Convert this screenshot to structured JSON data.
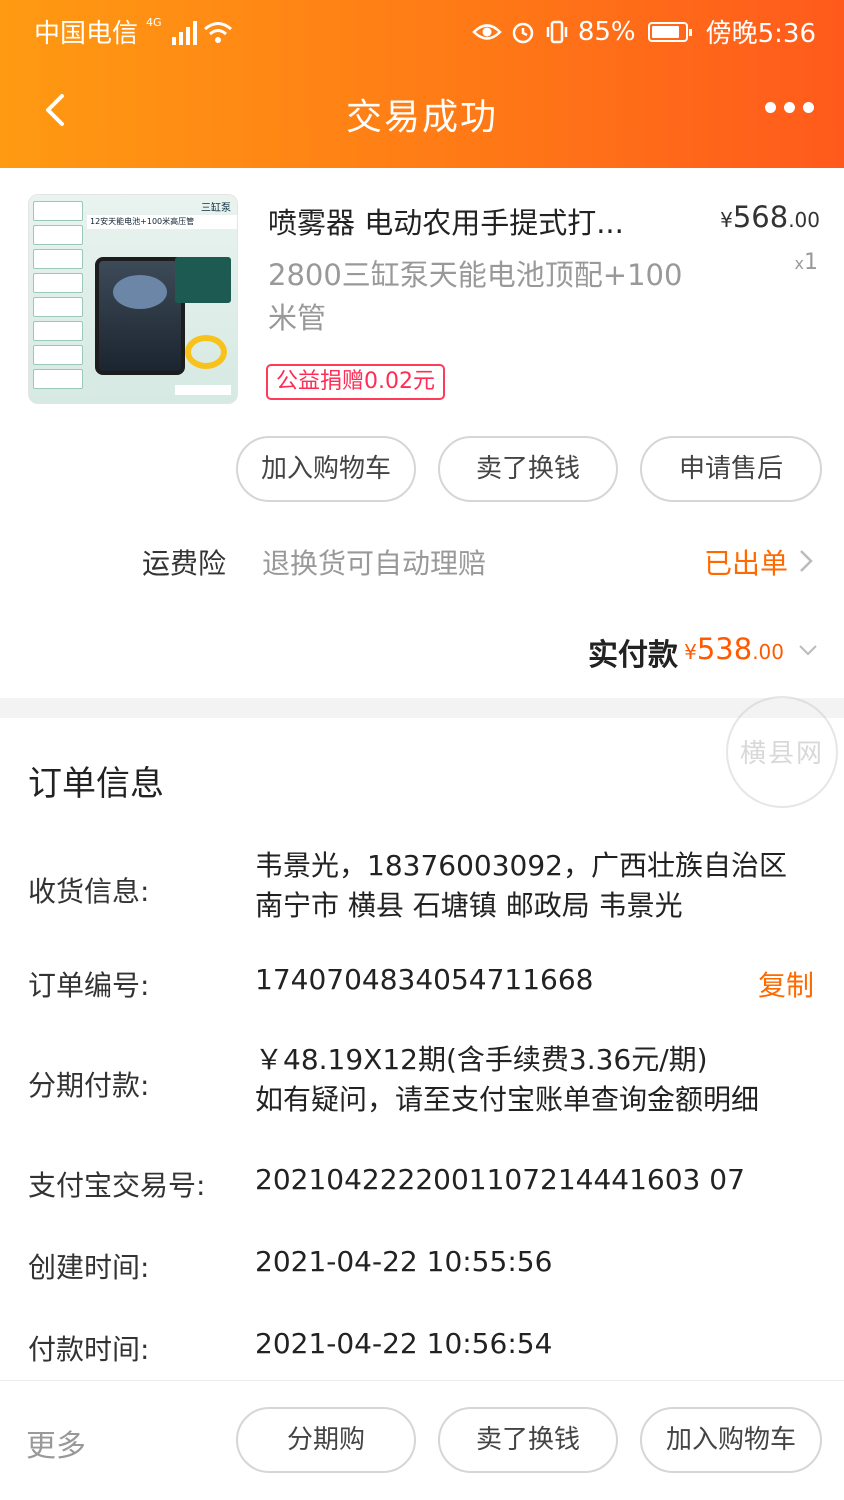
{
  "status_bar": {
    "carrier": "中国电信",
    "network": "4G",
    "battery": "85%",
    "battery_level": 0.85,
    "time": "傍晚5:36"
  },
  "nav": {
    "title": "交易成功"
  },
  "product": {
    "title": "喷雾器 电动农用手提式打...",
    "price_symbol": "¥",
    "price_int": "568",
    "price_dec": ".00",
    "qty_prefix": "x",
    "qty": "1",
    "sku": "2800三缸泵天能电池顶配+100米管",
    "badge": "公益捐赠0.02元",
    "image_text": {
      "tag": "三缸泵",
      "band": "12安天能电池+100米高压管"
    }
  },
  "item_actions": {
    "add_cart": "加入购物车",
    "resell": "卖了换钱",
    "after_sale": "申请售后"
  },
  "insurance": {
    "label": "运费险",
    "desc": "退换货可自动理赔",
    "status": "已出单"
  },
  "payment": {
    "label": "实付款",
    "symbol": "¥",
    "amount_int": "538",
    "amount_dec": ".00"
  },
  "watermark": {
    "text": "横县网"
  },
  "order_info": {
    "title": "订单信息",
    "receiver_label": "收货信息:",
    "receiver_line1": "韦景光，18376003092，广西壮族自治区",
    "receiver_line2": "南宁市 横县 石塘镇 邮政局 韦景光",
    "order_no_label": "订单编号:",
    "order_no": "1740704834054711668",
    "copy": "复制",
    "installment_label": "分期付款:",
    "installment_line1": "￥48.19X12期(含手续费3.36元/期)",
    "installment_line2": "如有疑问，请至支付宝账单查询金额明细",
    "alipay_label": "支付宝交易号:",
    "alipay_no": "2021042222001107214441603 07",
    "created_label": "创建时间:",
    "created_time": "2021-04-22 10:55:56",
    "paid_label": "付款时间:",
    "paid_time": "2021-04-22 10:56:54"
  },
  "bottom_bar": {
    "more": "更多",
    "installment": "分期购",
    "resell": "卖了换钱",
    "add_cart": "加入购物车"
  },
  "colors": {
    "header_start": "#ff9a12",
    "header_end": "#ff5a1c",
    "accent": "#ff6a00",
    "badge": "#ff2d55"
  },
  "icons": [
    "back-arrow-icon",
    "more-dots-icon",
    "chevron-right-icon",
    "chevron-down-icon",
    "signal-icon",
    "wifi-icon",
    "eye-icon",
    "alarm-icon",
    "vibrate-icon",
    "battery-icon"
  ]
}
